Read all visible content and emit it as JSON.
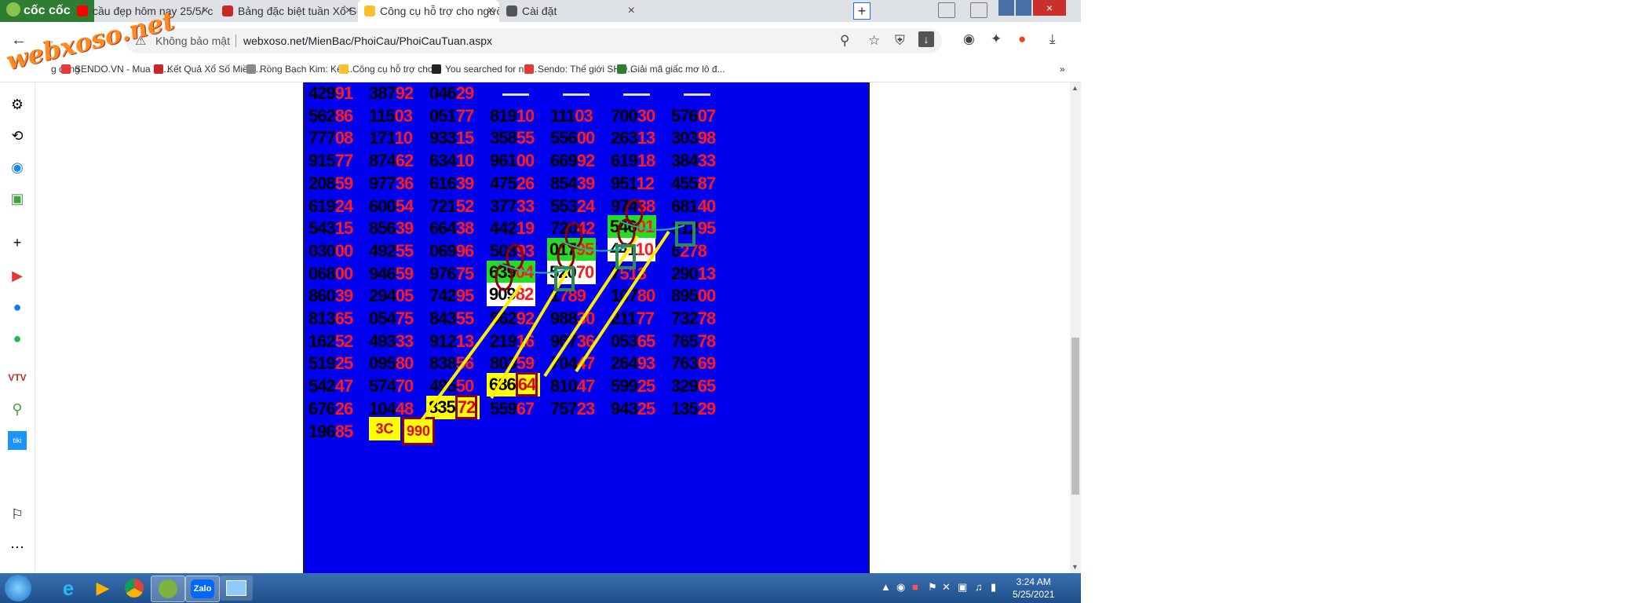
{
  "browser": {
    "logo_text": "cốc cốc",
    "tabs": [
      {
        "title": "cầu đẹp hôm nay 25/5/ cầu lô",
        "icon_color": "#ff0000"
      },
      {
        "title": "Bảng đặc biệt tuần Xổ Số Tru",
        "icon_color": "#c62828"
      },
      {
        "title": "Công cụ hỗ trợ cho người ch",
        "icon_color": "#fbc02d"
      },
      {
        "title": "Cài đặt",
        "icon_color": "#555555"
      }
    ],
    "new_tab": "+",
    "close_glyph": "×",
    "security_text": "Không bảo mật",
    "url": "webxoso.net/MienBac/PhoiCau/PhoiCauTuan.aspx",
    "bookmarks": [
      {
        "label": "g dụng",
        "color": "#ffffff"
      },
      {
        "label": "SENDO.VN - Mua hà...",
        "color": "#e53935"
      },
      {
        "label": "Kết Quả Xổ Số Miền...",
        "color": "#c62828"
      },
      {
        "label": "Rồng Bạch Kim: Kết...",
        "color": "#888888"
      },
      {
        "label": "Công cụ hỗ trợ cho...",
        "color": "#fbc02d"
      },
      {
        "label": "You searched for nh...",
        "color": "#222222"
      },
      {
        "label": "Sendo: Thế giới SHO...",
        "color": "#e53935"
      },
      {
        "label": "Giải mã giấc mơ lô đ...",
        "color": "#2e7d32"
      }
    ],
    "bookmarks_more": "»",
    "watermark": "webxoso.net"
  },
  "board": {
    "rows": [
      [
        [
          "429",
          "91"
        ],
        [
          "387",
          "92"
        ],
        [
          "046",
          "29"
        ],
        null,
        null,
        null,
        null
      ],
      [
        [
          "562",
          "86"
        ],
        [
          "115",
          "03"
        ],
        [
          "051",
          "77"
        ],
        [
          "819",
          "10"
        ],
        [
          "111",
          "03"
        ],
        [
          "700",
          "30"
        ],
        [
          "576",
          "07"
        ]
      ],
      [
        [
          "777",
          "08"
        ],
        [
          "171",
          "10"
        ],
        [
          "933",
          "15"
        ],
        [
          "358",
          "55"
        ],
        [
          "556",
          "00"
        ],
        [
          "263",
          "13"
        ],
        [
          "303",
          "98"
        ]
      ],
      [
        [
          "915",
          "77"
        ],
        [
          "874",
          "62"
        ],
        [
          "634",
          "10"
        ],
        [
          "961",
          "00"
        ],
        [
          "669",
          "92"
        ],
        [
          "619",
          "18"
        ],
        [
          "384",
          "33"
        ]
      ],
      [
        [
          "208",
          "59"
        ],
        [
          "977",
          "36"
        ],
        [
          "616",
          "39"
        ],
        [
          "475",
          "26"
        ],
        [
          "854",
          "39"
        ],
        [
          "951",
          "12"
        ],
        [
          "455",
          "87"
        ]
      ],
      [
        [
          "619",
          "24"
        ],
        [
          "600",
          "54"
        ],
        [
          "721",
          "52"
        ],
        [
          "377",
          "33"
        ],
        [
          "553",
          "24"
        ],
        [
          "974",
          "38"
        ],
        [
          "681",
          "40"
        ]
      ],
      [
        [
          "543",
          "15"
        ],
        [
          "856",
          "39"
        ],
        [
          "664",
          "38"
        ],
        [
          "442",
          "19"
        ],
        [
          "720",
          "42"
        ],
        null,
        [
          "312",
          "95"
        ]
      ],
      [
        [
          "030",
          "00"
        ],
        [
          "492",
          "55"
        ],
        [
          "069",
          "96"
        ],
        [
          "503",
          "93"
        ],
        null,
        null,
        [
          "6",
          "278"
        ]
      ],
      [
        [
          "068",
          "00"
        ],
        [
          "946",
          "59"
        ],
        [
          "976",
          "75"
        ],
        null,
        null,
        [
          "7",
          "513"
        ],
        [
          "290",
          "13"
        ]
      ],
      [
        [
          "860",
          "39"
        ],
        [
          "294",
          "05"
        ],
        [
          "742",
          "95"
        ],
        null,
        [
          "1",
          "789"
        ],
        [
          "107",
          "80"
        ],
        [
          "895",
          "00"
        ]
      ],
      [
        [
          "813",
          "65"
        ],
        [
          "054",
          "75"
        ],
        [
          "843",
          "55"
        ],
        [
          "562",
          "92"
        ],
        [
          "988",
          "30"
        ],
        [
          "211",
          "77"
        ],
        [
          "732",
          "78"
        ]
      ],
      [
        [
          "162",
          "52"
        ],
        [
          "493",
          "33"
        ],
        [
          "912",
          "13"
        ],
        [
          "219",
          "16"
        ],
        [
          "967",
          "36"
        ],
        [
          "053",
          "65"
        ],
        [
          "765",
          "78"
        ]
      ],
      [
        [
          "519",
          "25"
        ],
        [
          "095",
          "80"
        ],
        [
          "838",
          "56"
        ],
        [
          "803",
          "59"
        ],
        [
          "704",
          "47"
        ],
        [
          "264",
          "93"
        ],
        [
          "763",
          "69"
        ]
      ],
      [
        [
          "542",
          "47"
        ],
        [
          "574",
          "70"
        ],
        [
          "495",
          "50"
        ],
        null,
        [
          "810",
          "47"
        ],
        [
          "599",
          "25"
        ],
        [
          "329",
          "65"
        ]
      ],
      [
        [
          "676",
          "26"
        ],
        [
          "104",
          "48"
        ],
        null,
        [
          "559",
          "67"
        ],
        [
          "757",
          "23"
        ],
        [
          "943",
          "25"
        ],
        [
          "135",
          "29"
        ]
      ],
      [
        [
          "196",
          "85"
        ],
        null,
        null,
        null,
        null,
        null,
        null
      ]
    ],
    "highlights": [
      {
        "row": 6,
        "col": 5,
        "head": "546",
        "tail": "01",
        "bg": "#22dd22",
        "head_color": "#000000",
        "tail_color": "#ff1a1a"
      },
      {
        "row": 7,
        "col": 4,
        "head": "017",
        "tail": "95",
        "bg": "#22dd22",
        "head_color": "#000000",
        "tail_color": "#ff1a1a"
      },
      {
        "row": 7,
        "col": 5,
        "head": "441",
        "tail": "10",
        "bg": "#ffffff",
        "head_color": "#000000",
        "tail_color": "#ff1a1a"
      },
      {
        "row": 8,
        "col": 3,
        "head": "639",
        "tail": "04",
        "bg": "#22dd22",
        "head_color": "#000000",
        "tail_color": "#ff1a1a"
      },
      {
        "row": 8,
        "col": 4,
        "head": "520",
        "tail": "70",
        "bg": "#ffffff",
        "head_color": "#000000",
        "tail_color": "#ff1a1a"
      },
      {
        "row": 9,
        "col": 3,
        "head": "909",
        "tail": "82",
        "bg": "#ffffff",
        "head_color": "#000000",
        "tail_color": "#ff1a1a"
      },
      {
        "row": 13,
        "col": 3,
        "head": "686",
        "tail": "64",
        "bg": "#ffff00",
        "head_color": "#000000",
        "tail_color": "#e60000"
      },
      {
        "row": 14,
        "col": 2,
        "head": "835",
        "tail": "72",
        "bg": "#ffff00",
        "head_color": "#000000",
        "tail_color": "#e60000"
      }
    ],
    "badges": [
      {
        "text": "3C",
        "bg": "#ffff00"
      },
      {
        "text": "990",
        "bg": "#ffff00"
      }
    ]
  },
  "taskbar": {
    "time": "3:24 AM",
    "date": "5/25/2021",
    "zalo_label": "Zalo"
  }
}
